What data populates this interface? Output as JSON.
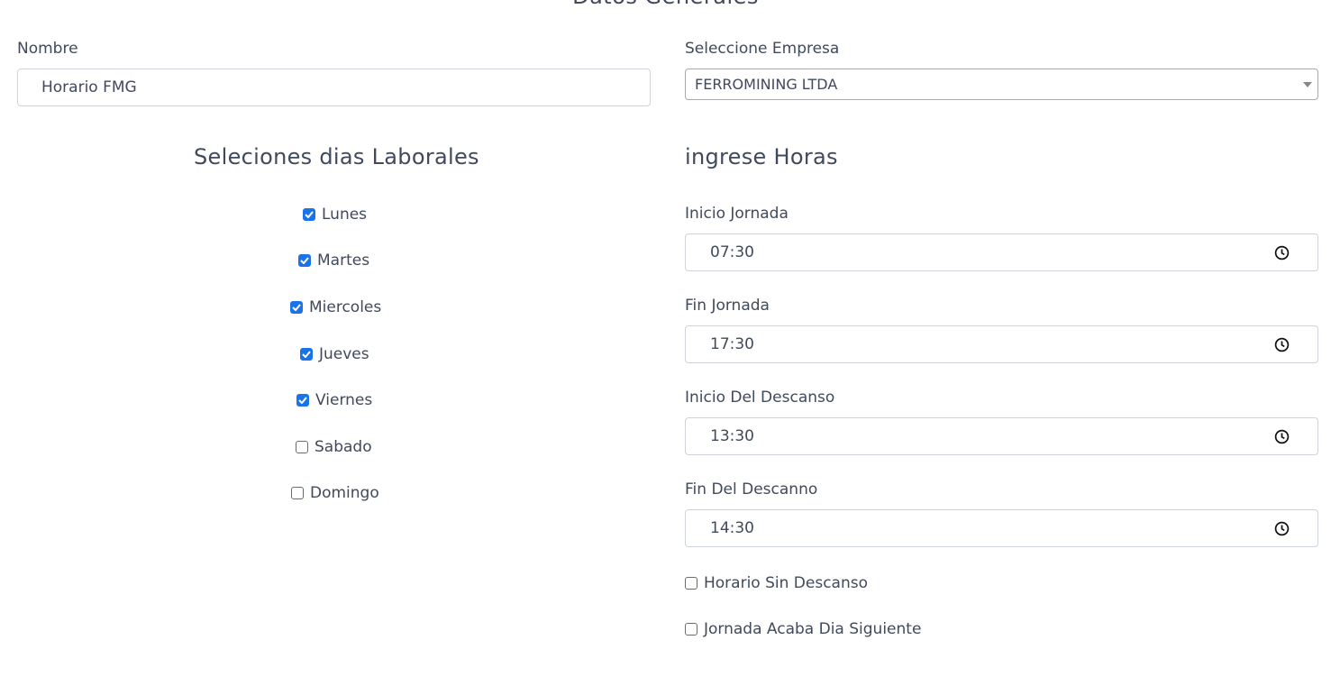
{
  "section": {
    "title": "Datos Generales"
  },
  "nombre": {
    "label": "Nombre",
    "value": "Horario FMG"
  },
  "empresa": {
    "label": "Seleccione Empresa",
    "selected": "FERROMINING LTDA"
  },
  "dias": {
    "heading": "Seleciones dias Laborales",
    "items": [
      {
        "label": "Lunes",
        "checked": true
      },
      {
        "label": "Martes",
        "checked": true
      },
      {
        "label": "Miercoles",
        "checked": true
      },
      {
        "label": "Jueves",
        "checked": true
      },
      {
        "label": "Viernes",
        "checked": true
      },
      {
        "label": "Sabado",
        "checked": false
      },
      {
        "label": "Domingo",
        "checked": false
      }
    ]
  },
  "horas": {
    "heading": "ingrese Horas",
    "fields": [
      {
        "label": "Inicio Jornada",
        "value": "07:30"
      },
      {
        "label": "Fin Jornada",
        "value": "17:30"
      },
      {
        "label": "Inicio Del Descanso",
        "value": "13:30"
      },
      {
        "label": "Fin Del Descanno",
        "value": "14:30"
      }
    ],
    "options": [
      {
        "label": "Horario Sin Descanso",
        "checked": false
      },
      {
        "label": "Jornada Acaba Dia Siguiente",
        "checked": false
      }
    ]
  },
  "colors": {
    "checkbox_checked": "#1a73e8",
    "text": "#3f4a5c",
    "border": "#cfd4da"
  }
}
